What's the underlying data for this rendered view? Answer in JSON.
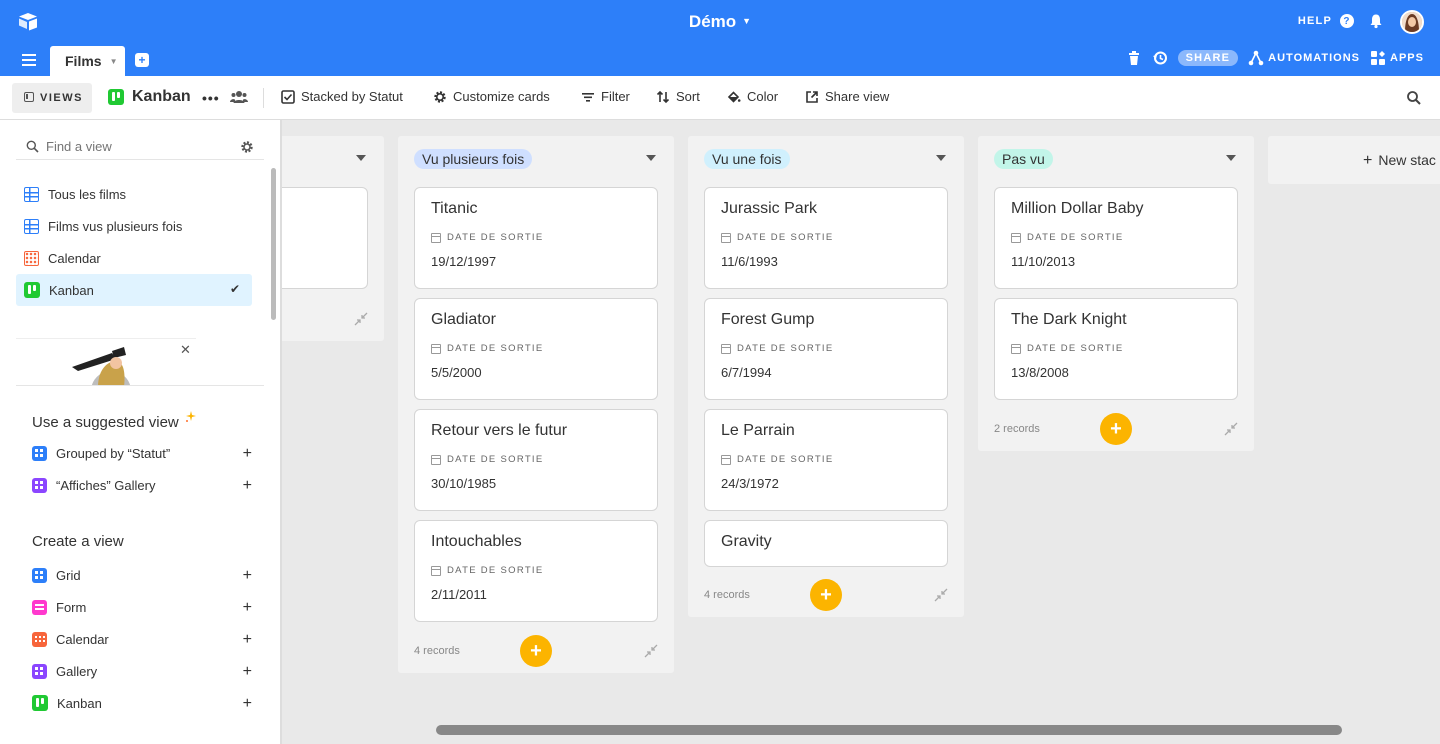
{
  "app": {
    "base_name": "Démo",
    "help_label": "HELP",
    "tab_label": "Films"
  },
  "tabbar": {
    "share_label": "SHARE",
    "automations_label": "AUTOMATIONS",
    "apps_label": "APPS"
  },
  "toolbar": {
    "views_label": "VIEWS",
    "view_name": "Kanban",
    "more_label": "•••",
    "stacked_label": "Stacked by Statut",
    "customize_label": "Customize cards",
    "filter_label": "Filter",
    "sort_label": "Sort",
    "color_label": "Color",
    "share_view_label": "Share view"
  },
  "sidebar": {
    "find_placeholder": "Find a view",
    "views": [
      {
        "label": "Tous les films",
        "icon": "grid-icon"
      },
      {
        "label": "Films vus plusieurs fois",
        "icon": "grid-icon"
      },
      {
        "label": "Calendar",
        "icon": "calendar-icon"
      },
      {
        "label": "Kanban",
        "icon": "kanban-icon",
        "active": true,
        "check": "✔"
      }
    ],
    "suggested_title": "Use a suggested view",
    "suggested": [
      {
        "label": "Grouped by “Statut”",
        "icon": "grid-icon"
      },
      {
        "label": "“Affiches” Gallery",
        "icon": "gallery-icon"
      }
    ],
    "create_title": "Create a view",
    "create": [
      {
        "label": "Grid",
        "icon": "grid-icon"
      },
      {
        "label": "Form",
        "icon": "form-icon"
      },
      {
        "label": "Calendar",
        "icon": "calendar-icon"
      },
      {
        "label": "Gallery",
        "icon": "gallery-icon"
      },
      {
        "label": "Kanban",
        "icon": "kanban-icon"
      }
    ]
  },
  "board": {
    "field_label": "DATE DE SORTIE",
    "new_stack_label": "New stac",
    "stacks": [
      {
        "label": "Vu plusieurs fois",
        "color": "#cfdfff",
        "count": "4 records",
        "cards": [
          {
            "title": "Titanic",
            "date": "19/12/1997"
          },
          {
            "title": "Gladiator",
            "date": "5/5/2000"
          },
          {
            "title": "Retour vers le futur",
            "date": "30/10/1985"
          },
          {
            "title": "Intouchables",
            "date": "2/11/2011"
          }
        ]
      },
      {
        "label": "Vu une fois",
        "color": "#d0f0fd",
        "count": "4 records",
        "cards": [
          {
            "title": "Jurassic Park",
            "date": "11/6/1993"
          },
          {
            "title": "Forest Gump",
            "date": "6/7/1994"
          },
          {
            "title": "Le Parrain",
            "date": "24/3/1972"
          },
          {
            "title": "Gravity",
            "date": ""
          }
        ]
      },
      {
        "label": "Pas vu",
        "color": "#c2f5e9",
        "count": "2 records",
        "cards": [
          {
            "title": "Million Dollar Baby",
            "date": "11/10/2013"
          },
          {
            "title": "The Dark Knight",
            "date": "13/8/2008"
          }
        ]
      }
    ]
  },
  "colors": {
    "brand": "#2d7ff9",
    "add_button": "#fcb400",
    "active_view": "#e0f3ff"
  }
}
